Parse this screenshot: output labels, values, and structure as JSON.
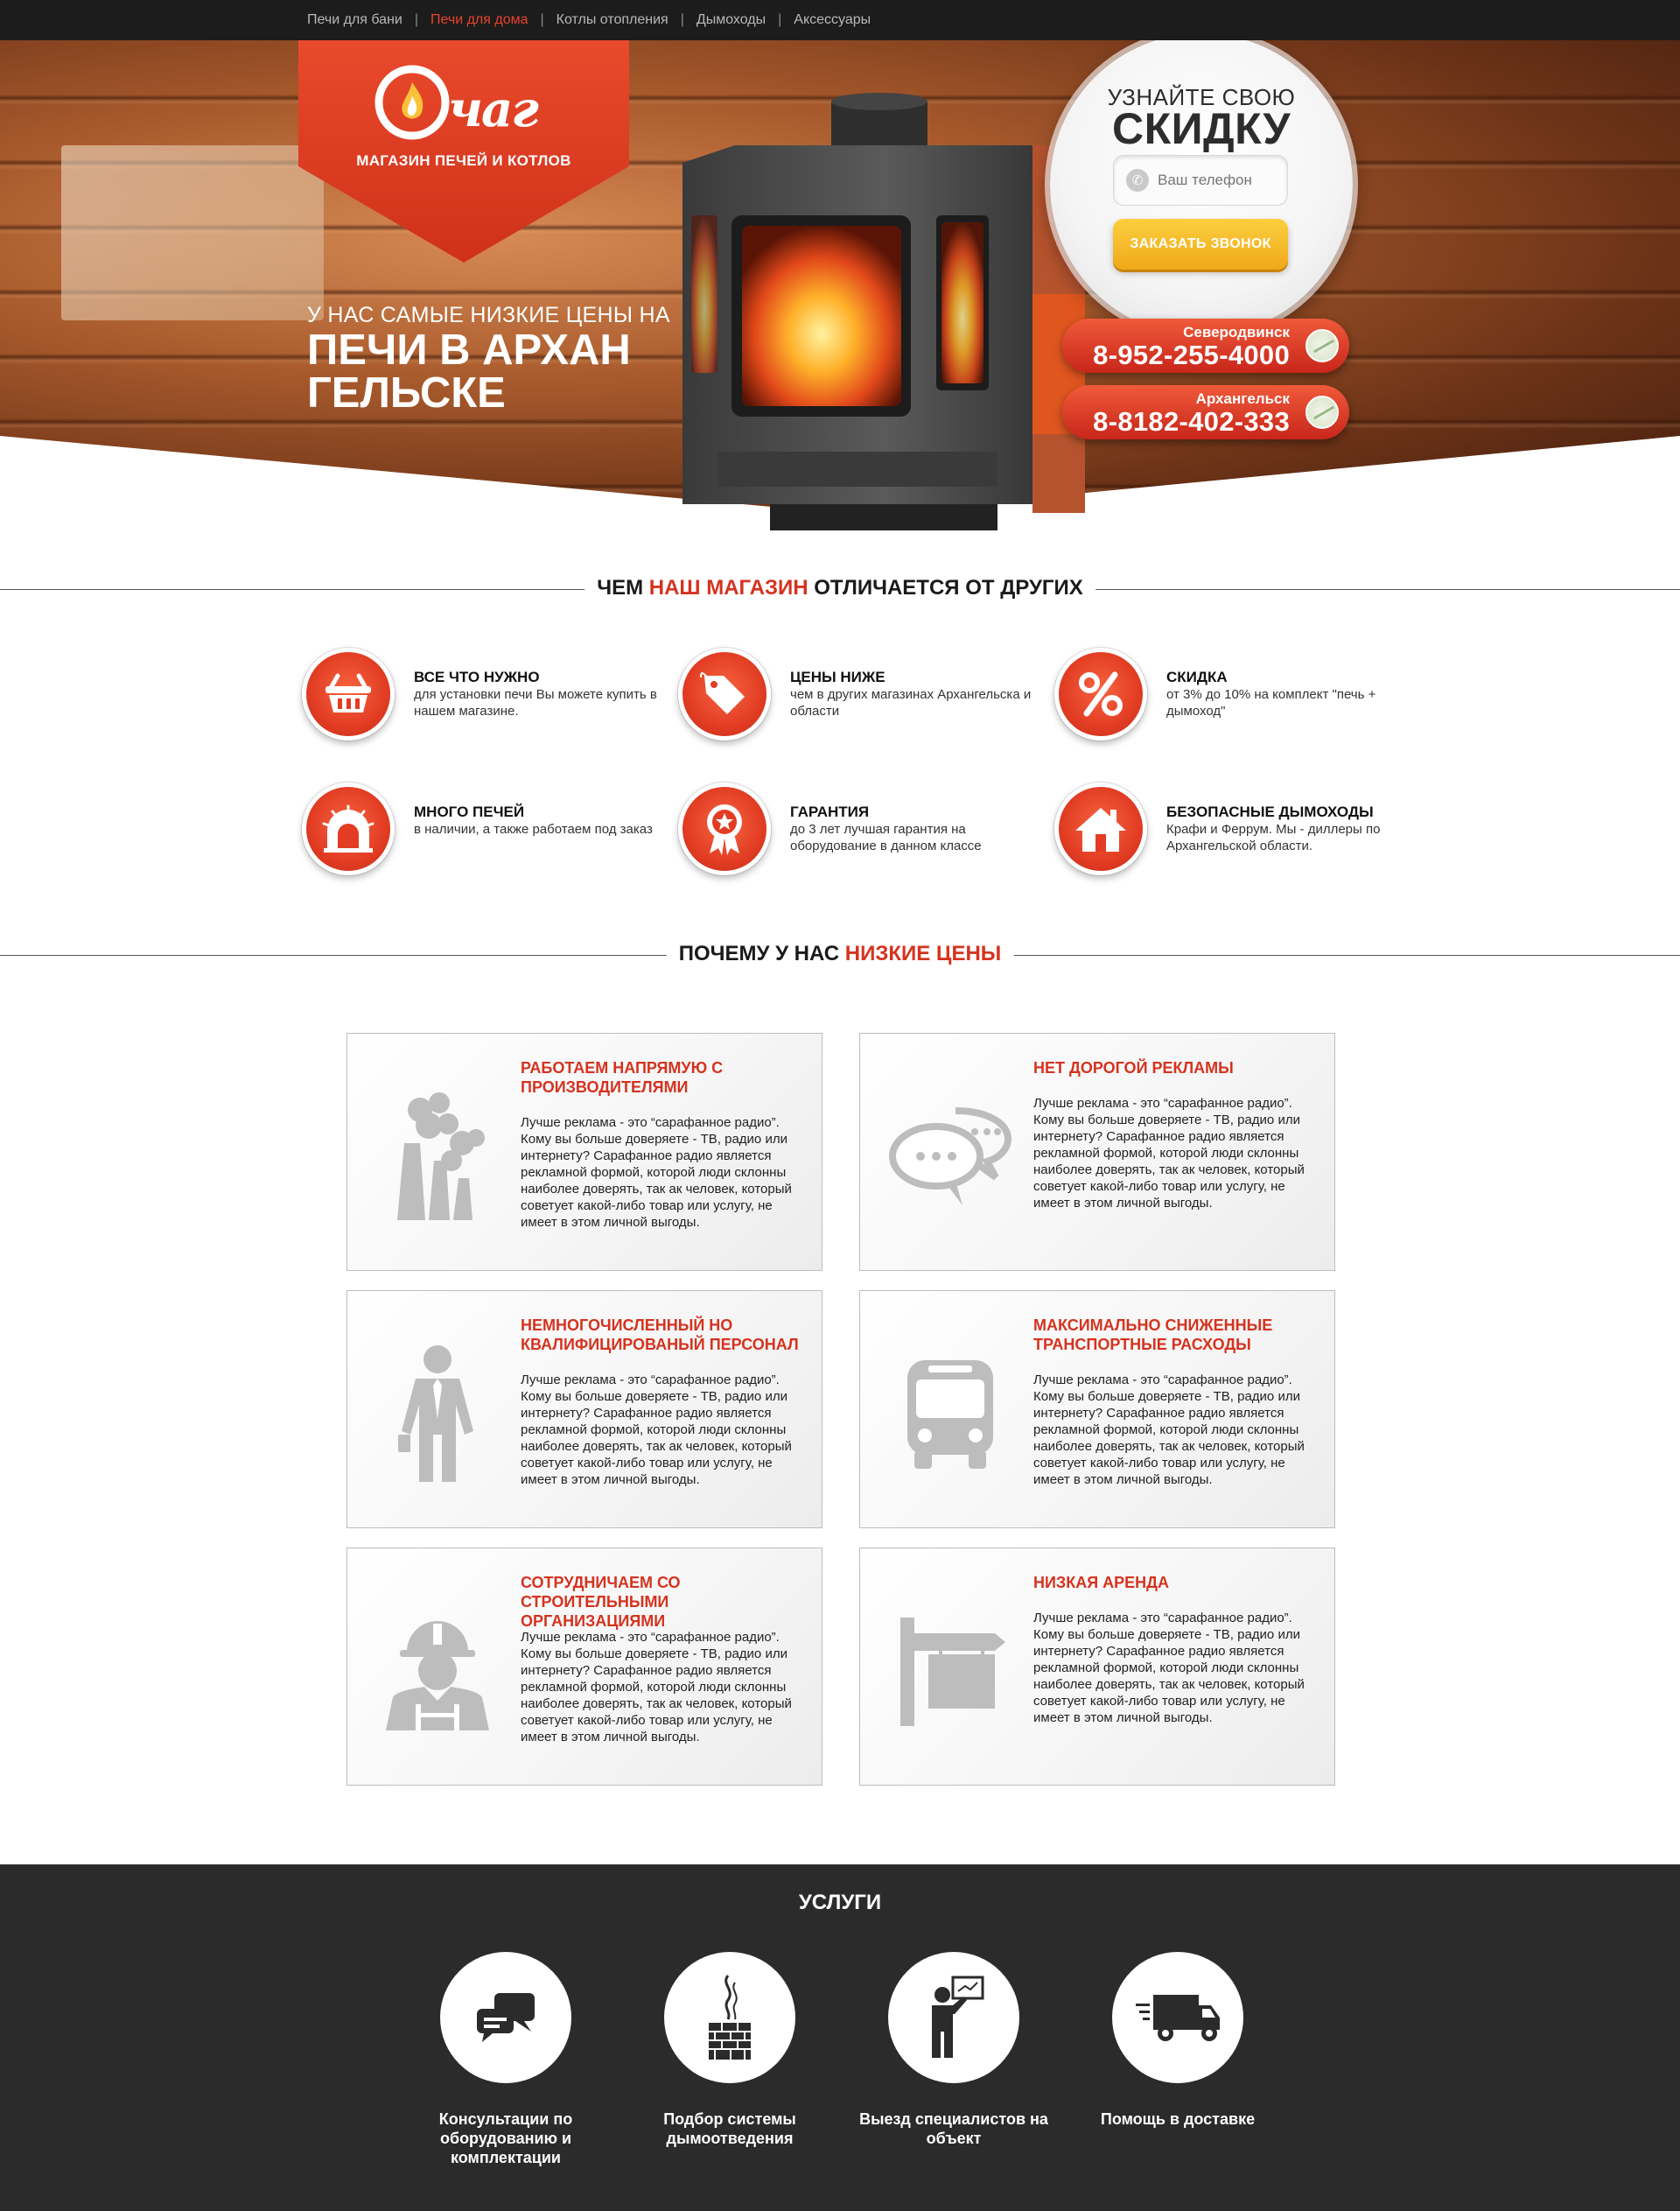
{
  "nav": {
    "items": [
      {
        "label": "Печи для бани"
      },
      {
        "label": "Печи для дома"
      },
      {
        "label": "Котлы отопления"
      },
      {
        "label": "Дымоходы"
      },
      {
        "label": "Аксессуары"
      }
    ],
    "active_index": 1
  },
  "logo": {
    "word": "чаг",
    "tagline": "МАГАЗИН ПЕЧЕЙ И КОТЛОВ"
  },
  "hero": {
    "subtitle": "У НАС САМЫЕ НИЗКИЕ ЦЕНЫ НА",
    "title": "ПЕЧИ В АРХАНГЕЛЬСКЕ"
  },
  "discount": {
    "line1": "УЗНАЙТЕ СВОЮ",
    "line2": "СКИДКУ",
    "phone_placeholder": "Ваш телефон",
    "button_label": "ЗАКАЗАТЬ ЗВОНОК"
  },
  "phones": [
    {
      "city": "Северодвинск",
      "number": "8-952-255-4000"
    },
    {
      "city": "Архангельск",
      "number": "8-8182-402-333"
    }
  ],
  "features_section": {
    "title_before": "ЧЕМ",
    "title_accent": "НАШ МАГАЗИН",
    "title_after": "ОТЛИЧАЕТСЯ ОТ ДРУГИХ"
  },
  "features": [
    {
      "title": "ВСЕ ЧТО НУЖНО",
      "text": "для установки печи Вы можете купить в нашем магазине.",
      "icon": "basket-icon"
    },
    {
      "title": "ЦЕНЫ НИЖЕ",
      "text": "чем в других магазинах Архангельска и области",
      "icon": "price-tag-icon"
    },
    {
      "title": "СКИДКА",
      "text": "от 3% до 10% на комплект \"печь + дымоход\"",
      "icon": "percent-icon"
    },
    {
      "title": "МНОГО ПЕЧЕЙ",
      "text": "в наличии, а также работаем под заказ",
      "icon": "stove-icon"
    },
    {
      "title": "ГАРАНТИЯ",
      "text": "до 3 лет лучшая гарантия на оборудование в данном классе",
      "icon": "award-icon"
    },
    {
      "title": "БЕЗОПАСНЫЕ ДЫМОХОДЫ",
      "text": "Крафи и Феррум. Мы - диллеры по Архангельской области.",
      "icon": "house-icon"
    }
  ],
  "reasons_section": {
    "title_before": "ПОЧЕМУ У НАС",
    "title_accent": "НИЗКИЕ ЦЕНЫ"
  },
  "reasons": [
    {
      "title": "РАБОТАЕМ НАПРЯМУЮ С ПРОИЗВОДИТЕЛЯМИ",
      "text": "Лучше реклама - это “сарафанное радио”. Кому вы больше доверяете - ТВ, радио или интернету? Сарафанное радио является рекламной формой, которой люди склонны наиболее доверять, так ак человек, который советует какой-либо товар или услугу, не имеет в этом личной выгоды.",
      "icon": "factory-icon"
    },
    {
      "title": "НЕТ ДОРОГОЙ РЕКЛАМЫ",
      "text": "Лучше реклама - это “сарафанное радио”. Кому вы больше доверяете - ТВ, радио или интернету? Сарафанное радио является рекламной формой, которой люди склонны наиболее доверять, так ак человек, который советует какой-либо товар или услугу, не имеет в этом личной выгоды.",
      "icon": "chat-bubbles-icon"
    },
    {
      "title": "НЕМНОГОЧИСЛЕННЫЙ НО КВАЛИФИЦИРОВАНЫЙ ПЕРСОНАЛ",
      "text": "Лучше реклама - это “сарафанное радио”. Кому вы больше доверяете - ТВ, радио или интернету? Сарафанное радио является рекламной формой, которой люди склонны наиболее доверять, так ак человек, который советует какой-либо товар или услугу, не имеет в этом личной выгоды.",
      "icon": "businessman-icon"
    },
    {
      "title": "МАКСИМАЛЬНО СНИЖЕННЫЕ ТРАНСПОРТНЫЕ РАСХОДЫ",
      "text": "Лучше реклама - это “сарафанное радио”. Кому вы больше доверяете - ТВ, радио или интернету? Сарафанное радио является рекламной формой, которой люди склонны наиболее доверять, так ак человек, который советует какой-либо товар или услугу, не имеет в этом личной выгоды.",
      "icon": "bus-icon"
    },
    {
      "title": "СОТРУДНИЧАЕМ СО СТРОИТЕЛЬНЫМИ ОРГАНИЗАЦИЯМИ",
      "text": "Лучше реклама - это “сарафанное радио”. Кому вы больше доверяете - ТВ, радио или интернету? Сарафанное радио является рекламной формой, которой люди склонны наиболее доверять, так ак человек, который советует какой-либо товар или услугу, не имеет в этом личной выгоды.",
      "icon": "builder-icon"
    },
    {
      "title": "НИЗКАЯ АРЕНДА",
      "text": "Лучше реклама - это “сарафанное радио”. Кому вы больше доверяете - ТВ, радио или интернету? Сарафанное радио является рекламной формой, которой люди склонны наиболее доверять, так ак человек, который советует какой-либо товар или услугу, не имеет в этом личной выгоды.",
      "icon": "signboard-icon"
    }
  ],
  "services": {
    "title": "УСЛУГИ",
    "items": [
      {
        "label": "Консультации по оборудованию и комплектации",
        "icon": "consult-chat-icon"
      },
      {
        "label": "Подбор системы дымоотведения",
        "icon": "chimney-icon"
      },
      {
        "label": "Выезд специалистов на объект",
        "icon": "presenter-icon"
      },
      {
        "label": "Помощь в доставке",
        "icon": "delivery-truck-icon"
      }
    ]
  },
  "colors": {
    "accent": "#d5331f",
    "dark": "#1c1c1c",
    "button": "#f4b928",
    "footer": "#2b2b2b"
  }
}
